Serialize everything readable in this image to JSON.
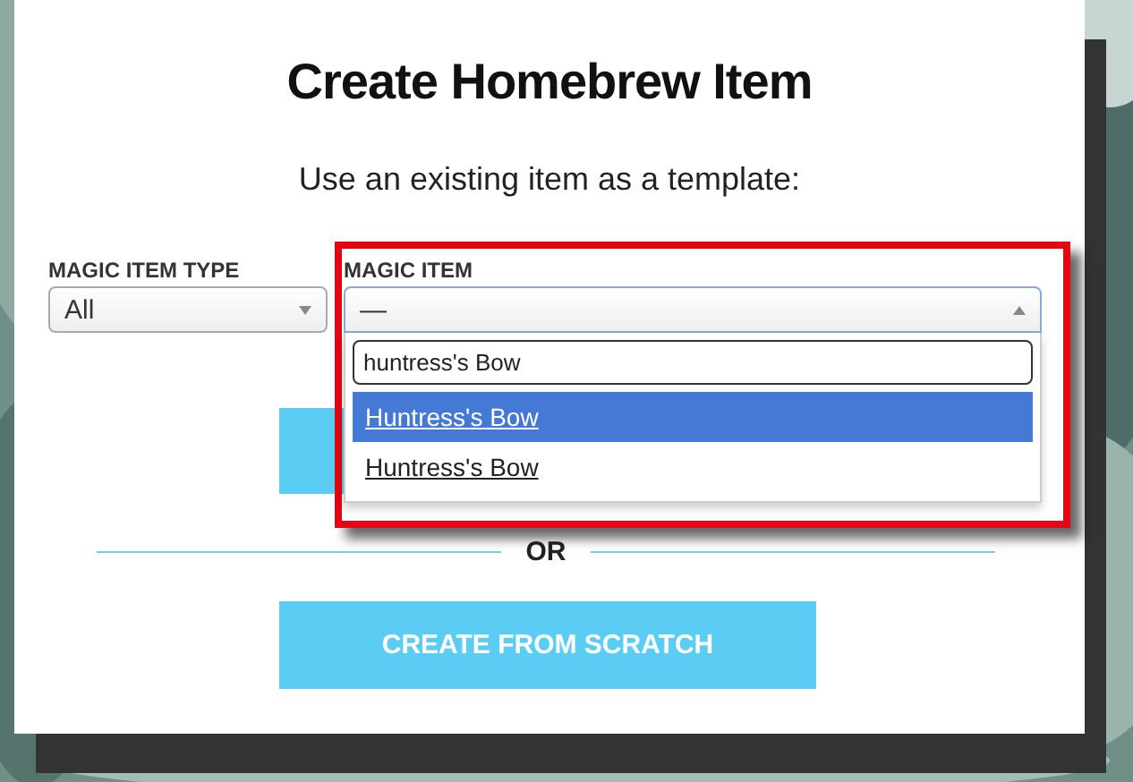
{
  "dialog": {
    "title": "Create Homebrew Item",
    "subtitle": "Use an existing item as a template:"
  },
  "fields": [
    {
      "label": "MAGIC ITEM TYPE",
      "value": "All",
      "expanded": false
    },
    {
      "label": "MAGIC ITEM",
      "value": "—",
      "expanded": true
    }
  ],
  "dropdown": {
    "search": "huntress's Bow",
    "options": [
      {
        "label": "Huntress's Bow",
        "selected": true
      },
      {
        "label": "Huntress's Bow",
        "selected": false
      }
    ]
  },
  "divider": "OR",
  "button": "CREATE FROM SCRATCH"
}
